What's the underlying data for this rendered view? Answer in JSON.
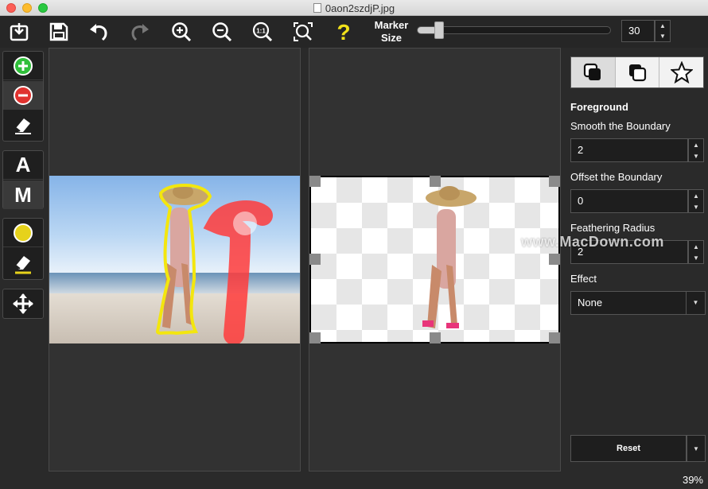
{
  "window": {
    "title": "0aon2szdjP.jpg"
  },
  "toolbar": {
    "buttons": [
      {
        "icon": "import-icon"
      },
      {
        "icon": "save-icon"
      },
      {
        "icon": "undo-icon"
      },
      {
        "icon": "redo-icon"
      },
      {
        "icon": "zoom-in-icon"
      },
      {
        "icon": "zoom-out-icon"
      },
      {
        "icon": "zoom-actual-icon",
        "text": "1:1"
      },
      {
        "icon": "zoom-fit-icon"
      },
      {
        "icon": "help-icon",
        "text": "?"
      }
    ],
    "marker_label_line1": "Marker",
    "marker_label_line2": "Size",
    "marker_size": "30",
    "marker_slider_fraction": 0.1
  },
  "tools": {
    "keep_icon": "plus-circle-icon",
    "remove_icon": "minus-circle-icon",
    "eraser_icon": "eraser-icon",
    "auto_label": "A",
    "manual_label": "M",
    "hair_icon": "yellow-circle-icon",
    "hair_eraser_icon": "eraser-yellow-icon",
    "move_icon": "move-icon"
  },
  "sidebar": {
    "tabs": [
      "foreground-tab",
      "background-tab",
      "save-tab"
    ],
    "section_title": "Foreground",
    "smooth_label": "Smooth the Boundary",
    "smooth_value": "2",
    "offset_label": "Offset the Boundary",
    "offset_value": "0",
    "feather_label": "Feathering Radius",
    "feather_value": "2",
    "effect_label": "Effect",
    "effect_value": "None",
    "reset_label": "Reset"
  },
  "status": {
    "zoom": "39%"
  },
  "watermark": "www.MacDown.com",
  "colors": {
    "keep_green": "#2fbf3a",
    "remove_red": "#e0322f",
    "hair_yellow": "#e6d21b",
    "marker_red": "#ff3b3b",
    "outline_yellow": "#f3e60e"
  }
}
